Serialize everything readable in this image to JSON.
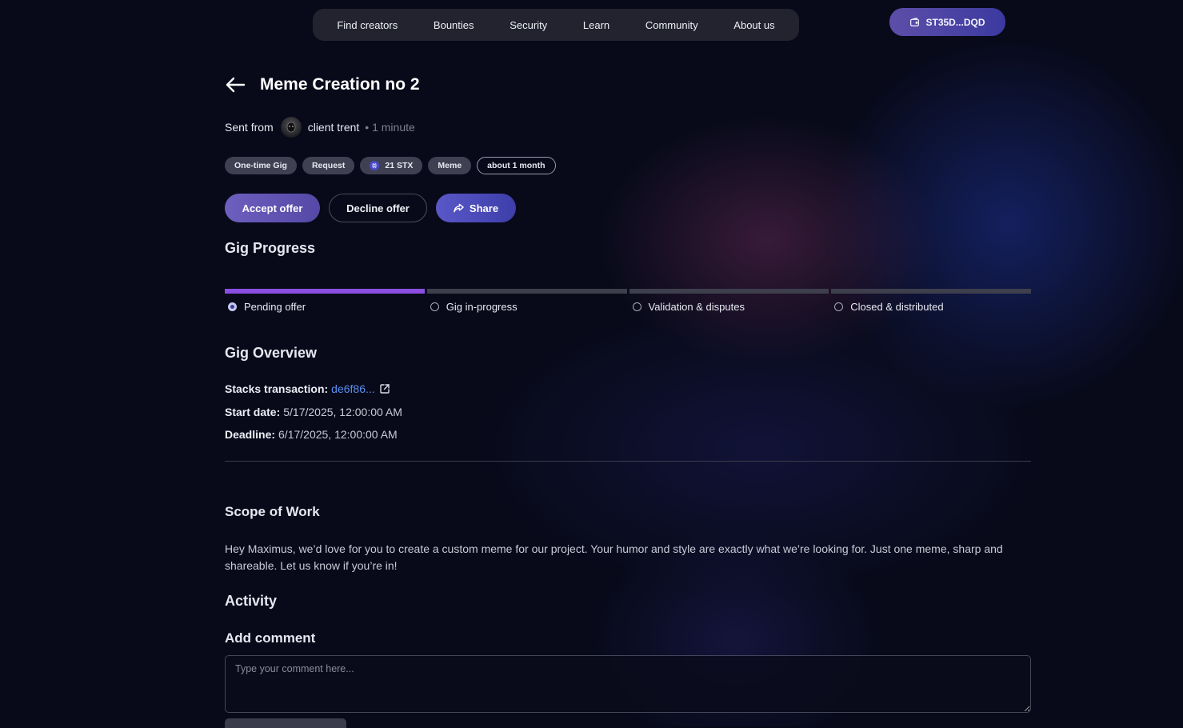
{
  "nav": {
    "items": [
      "Find creators",
      "Bounties",
      "Security",
      "Learn",
      "Community",
      "About us"
    ],
    "wallet_label": "ST35D...DQD"
  },
  "gig": {
    "title": "Meme Creation no 2",
    "sent_from_label": "Sent from",
    "client_name": "client trent",
    "time_ago": "• 1 minute",
    "badges": [
      "One-time Gig",
      "Request",
      "21 STX",
      "Meme",
      "about 1 month"
    ],
    "actions": {
      "accept": "Accept offer",
      "decline": "Decline offer",
      "share": "Share"
    }
  },
  "progress": {
    "heading": "Gig Progress",
    "current_step": 0,
    "steps": [
      "Pending offer",
      "Gig in-progress",
      "Validation & disputes",
      "Closed & distributed"
    ]
  },
  "overview": {
    "heading": "Gig Overview",
    "transaction_label": "Stacks transaction:",
    "transaction_value": "de6f86...",
    "start_label": "Start date:",
    "start_value": "5/17/2025, 12:00:00 AM",
    "deadline_label": "Deadline:",
    "deadline_value": "6/17/2025, 12:00:00 AM"
  },
  "scope": {
    "heading": "Scope of Work",
    "text": "Hey Maximus, we’d love for you to create a custom meme for our project. Your humor and style are exactly what we’re looking for. Just one meme, sharp and shareable. Let us know if you’re in!"
  },
  "activity": {
    "heading": "Activity",
    "add_comment_heading": "Add comment",
    "comment_placeholder": "Type your comment here...",
    "comment_value": ""
  },
  "colors": {
    "background": "#080a1a",
    "accent_purple": "#8a4ee0",
    "link_blue": "#5c8ff0",
    "button_purple": "#6e5fbe"
  },
  "icons": {
    "back": "arrow-left-icon",
    "wallet": "wallet-icon",
    "share": "share-icon",
    "external": "external-link-icon",
    "stx": "stacks-token-icon"
  }
}
